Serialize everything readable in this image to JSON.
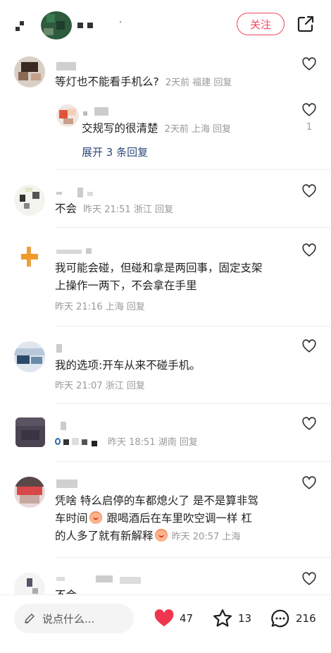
{
  "header": {
    "follow_label": "关注"
  },
  "comments": [
    {
      "text": "等灯也不能看手机么?",
      "time": "2天前",
      "location": "福建",
      "reply_label": "回复",
      "reply": {
        "text": "交规写的很清楚",
        "time": "2天前",
        "location": "上海",
        "reply_label": "回复",
        "likes": "1"
      },
      "expand_label": "展开 3 条回复"
    },
    {
      "text": "不会",
      "time": "昨天 21:51",
      "location": "浙江",
      "reply_label": "回复"
    },
    {
      "text_line1": "我可能会碰，但碰和拿是两回事，固定支架",
      "text_line2": "上操作一两下，不会拿在手里",
      "time": "昨天 21:16",
      "location": "上海",
      "reply_label": "回复"
    },
    {
      "text": "我的选项:开车从来不碰手机。",
      "time": "昨天 21:07",
      "location": "浙江",
      "reply_label": "回复"
    },
    {
      "time": "昨天 18:51",
      "location": "湖南",
      "reply_label": "回复"
    },
    {
      "text_line1": "凭啥 特么启停的车都熄火了 是不是算非驾",
      "text_line2a": "车时间",
      "text_line2b": " 跟喝酒后在车里吹空调一样 杠",
      "text_line3": "的人多了就有新解释",
      "time": "昨天 20:57",
      "location": "上海"
    },
    {
      "text": "不会"
    }
  ],
  "bottom_bar": {
    "input_placeholder": "说点什么...",
    "likes": "47",
    "favorites": "13",
    "comments": "216"
  },
  "colors": {
    "accent": "#f0485f",
    "link": "#2c4a7a",
    "meta": "#999999"
  }
}
